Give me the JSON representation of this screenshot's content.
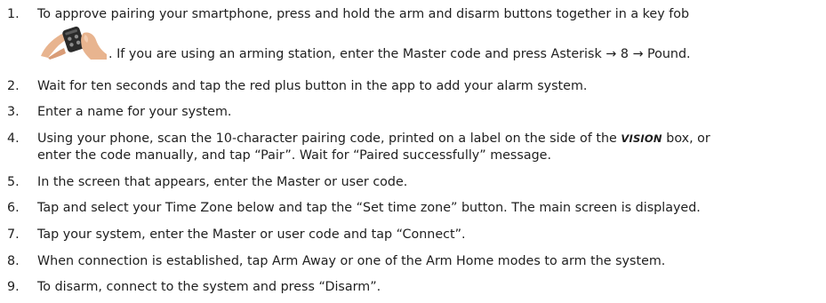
{
  "steps": [
    {
      "number": "1.",
      "line1": "To approve pairing your smartphone, press and hold the arm and disarm buttons together in a key fob",
      "line2": ". If you are using an arming station, enter the Master code and press Asterisk → 8 → Pound."
    },
    {
      "number": "2.",
      "text": "Wait for ten seconds and tap the red plus button in the app to add your alarm system."
    },
    {
      "number": "3.",
      "text": "Enter a name for your system."
    },
    {
      "number": "4.",
      "line1_before": "Using your phone, scan the 10-character pairing code, printed on a label on the side of the ",
      "emphasis": "VISION",
      "line1_after": " box, or",
      "line2": "enter the code manually, and tap “Pair”. Wait for “Paired successfully” message."
    },
    {
      "number": "5.",
      "text": "In the screen that appears, enter the Master or user code."
    },
    {
      "number": "6.",
      "text": "Tap and select your Time Zone below and tap the “Set time zone” button. The main screen is displayed."
    },
    {
      "number": "7.",
      "text": "Tap your system, enter the Master or user code and tap “Connect”."
    },
    {
      "number": "8.",
      "text": "When connection is established, tap Arm Away or one of the Arm Home modes to arm the system."
    },
    {
      "number": "9.",
      "text": "To disarm, connect to the system and press “Disarm”."
    }
  ],
  "icons": {
    "key_fob": "hands-pressing-key-fob-icon"
  },
  "colors": {
    "text": "#1f1f1f",
    "background": "#ffffff"
  }
}
